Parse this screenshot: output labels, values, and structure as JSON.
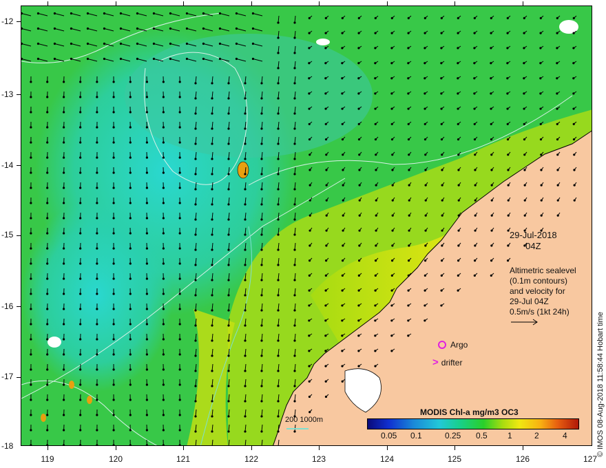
{
  "map": {
    "y_ticks": [
      "-12",
      "-13",
      "-14",
      "-15",
      "-16",
      "-17",
      "-18"
    ],
    "x_ticks": [
      "119",
      "120",
      "121",
      "122",
      "123",
      "124",
      "125",
      "126",
      "127"
    ],
    "lat_range": [
      -18,
      -11.7
    ],
    "lon_range": [
      118.6,
      127
    ]
  },
  "annotation": {
    "date": "29-Jul-2018",
    "time": "04Z",
    "info_lines": [
      "Altimetric sealevel",
      "(0.1m contours)",
      "and velocity for",
      "29-Jul 04Z",
      "0.5m/s (1kt 24h)"
    ]
  },
  "legend": {
    "argo": "Argo",
    "drifter": "drifter",
    "drifter_symbol": ">",
    "depth": "200  1000m"
  },
  "colorbar": {
    "title": "MODIS Chl-a mg/m3 OC3",
    "labels": [
      "0.05",
      "0.1",
      "0.25",
      "0.5",
      "1",
      "2",
      "4"
    ]
  },
  "credit": "© IMOS 08-Aug-2018 11:58:44 Hobart time",
  "colors": {
    "land": "#f8c8a0",
    "argo": "#e020e0",
    "ocean_low": "#2ad0c8",
    "ocean_high": "#30c040"
  }
}
